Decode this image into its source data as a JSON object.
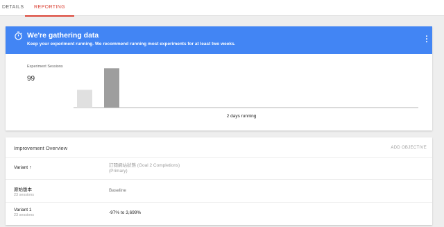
{
  "tabs": [
    {
      "label": "DETAILS",
      "active": false
    },
    {
      "label": "REPORTING",
      "active": true
    }
  ],
  "banner": {
    "title": "We're gathering data",
    "subtitle": "Keep your experiment running. We recommend running most experiments for at least two weeks.",
    "color": "#4285f4"
  },
  "sessions": {
    "label": "Experiment Sessions",
    "value": "99"
  },
  "chart_data": {
    "type": "bar",
    "categories": [
      "",
      ""
    ],
    "values": [
      28,
      62
    ],
    "colors": [
      "#e0e0e0",
      "#9e9e9e"
    ],
    "xlabel": "2 days running",
    "ylim": [
      0,
      70
    ],
    "grid": false
  },
  "overview": {
    "title": "Improvement Overview",
    "add_objective": "ADD OBJECTIVE",
    "columns": {
      "variant": "Variant",
      "objective_line1": "訂閱網站狀態 (Goal 2 Completions)",
      "objective_line2": "(Primary)"
    },
    "rows": [
      {
        "name": "原始版本",
        "sessions": "23 sessions",
        "value": "Baseline"
      },
      {
        "name": "Variant 1",
        "sessions": "23 sessions",
        "value": "-97% to 3,699%"
      }
    ]
  },
  "accent_color": "#db4437"
}
